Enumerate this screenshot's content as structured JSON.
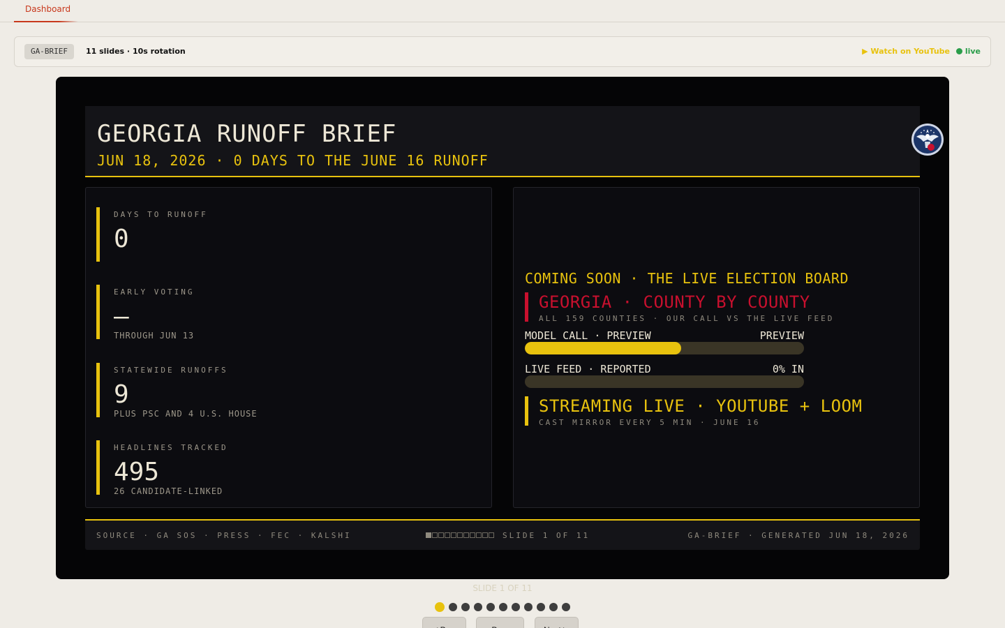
{
  "tabs": [
    {
      "label": "Dashboard"
    }
  ],
  "toolbar": {
    "tag": "GA-BRIEF",
    "slides_info": "11 slides · 10s rotation",
    "watch_label": "▶ Watch on YouTube",
    "live_label": "live"
  },
  "slide": {
    "title": "GEORGIA RUNOFF BRIEF",
    "subtitle": "JUN 18, 2026 · 0 DAYS TO THE JUNE 16 RUNOFF",
    "stats": [
      {
        "label": "DAYS TO RUNOFF",
        "value": "0",
        "note": ""
      },
      {
        "label": "EARLY VOTING",
        "value": "—",
        "note": "THROUGH JUN 13"
      },
      {
        "label": "STATEWIDE RUNOFFS",
        "value": "9",
        "note": "PLUS PSC AND 4 U.S. HOUSE"
      },
      {
        "label": "HEADLINES TRACKED",
        "value": "495",
        "note": "26 CANDIDATE-LINKED"
      }
    ],
    "coming_soon": "COMING SOON · THE LIVE ELECTION BOARD",
    "county_title": "GEORGIA · COUNTY BY COUNTY",
    "county_sub": "ALL 159 COUNTIES · OUR CALL VS THE LIVE FEED",
    "model_call": {
      "label": "MODEL CALL · PREVIEW",
      "right": "PREVIEW",
      "fill": 0.56
    },
    "live_feed": {
      "label": "LIVE FEED · REPORTED",
      "right": "0% IN",
      "fill": 0
    },
    "streaming_title": "STREAMING LIVE · YOUTUBE + LOOM",
    "streaming_sub": "CAST MIRROR EVERY 5 MIN · JUNE 16",
    "footer_source": "SOURCE · GA SOS · PRESS · FEC · KALSHI",
    "footer_slide": "SLIDE 1 OF 11",
    "footer_right": "GA-BRIEF · GENERATED JUN 18, 2026",
    "total_slides": 11,
    "current_slide": 1
  },
  "controls": {
    "counter": "SLIDE 1 OF 11",
    "prev": "◀ Prev",
    "pause": "⏸ Pause",
    "next": "Next ▶"
  },
  "colors": {
    "accent_yellow": "#e8c20e",
    "accent_red": "#c8102e",
    "live_green": "#2a9d4a",
    "tab_red": "#c8381c"
  }
}
